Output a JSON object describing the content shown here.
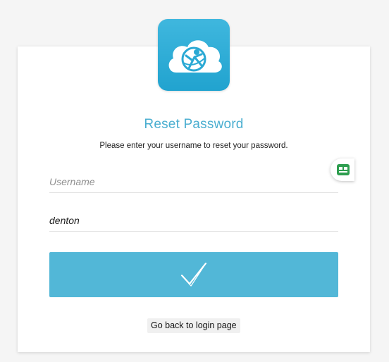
{
  "header": {
    "title": "Reset Password",
    "instructions": "Please enter your username to reset your password."
  },
  "form": {
    "username_placeholder": "Username",
    "text_value": "denton",
    "submit_icon": "checkmark-icon"
  },
  "footer": {
    "back_link": "Go back to login page"
  },
  "icons": {
    "logo": "cloud-app-logo-icon",
    "password_manager": "password-manager-icon"
  },
  "colors": {
    "accent": "#4aaed0",
    "button": "#52b7d7",
    "logo_background": "#2aa9d4",
    "password_manager": "#2e9e4f"
  }
}
